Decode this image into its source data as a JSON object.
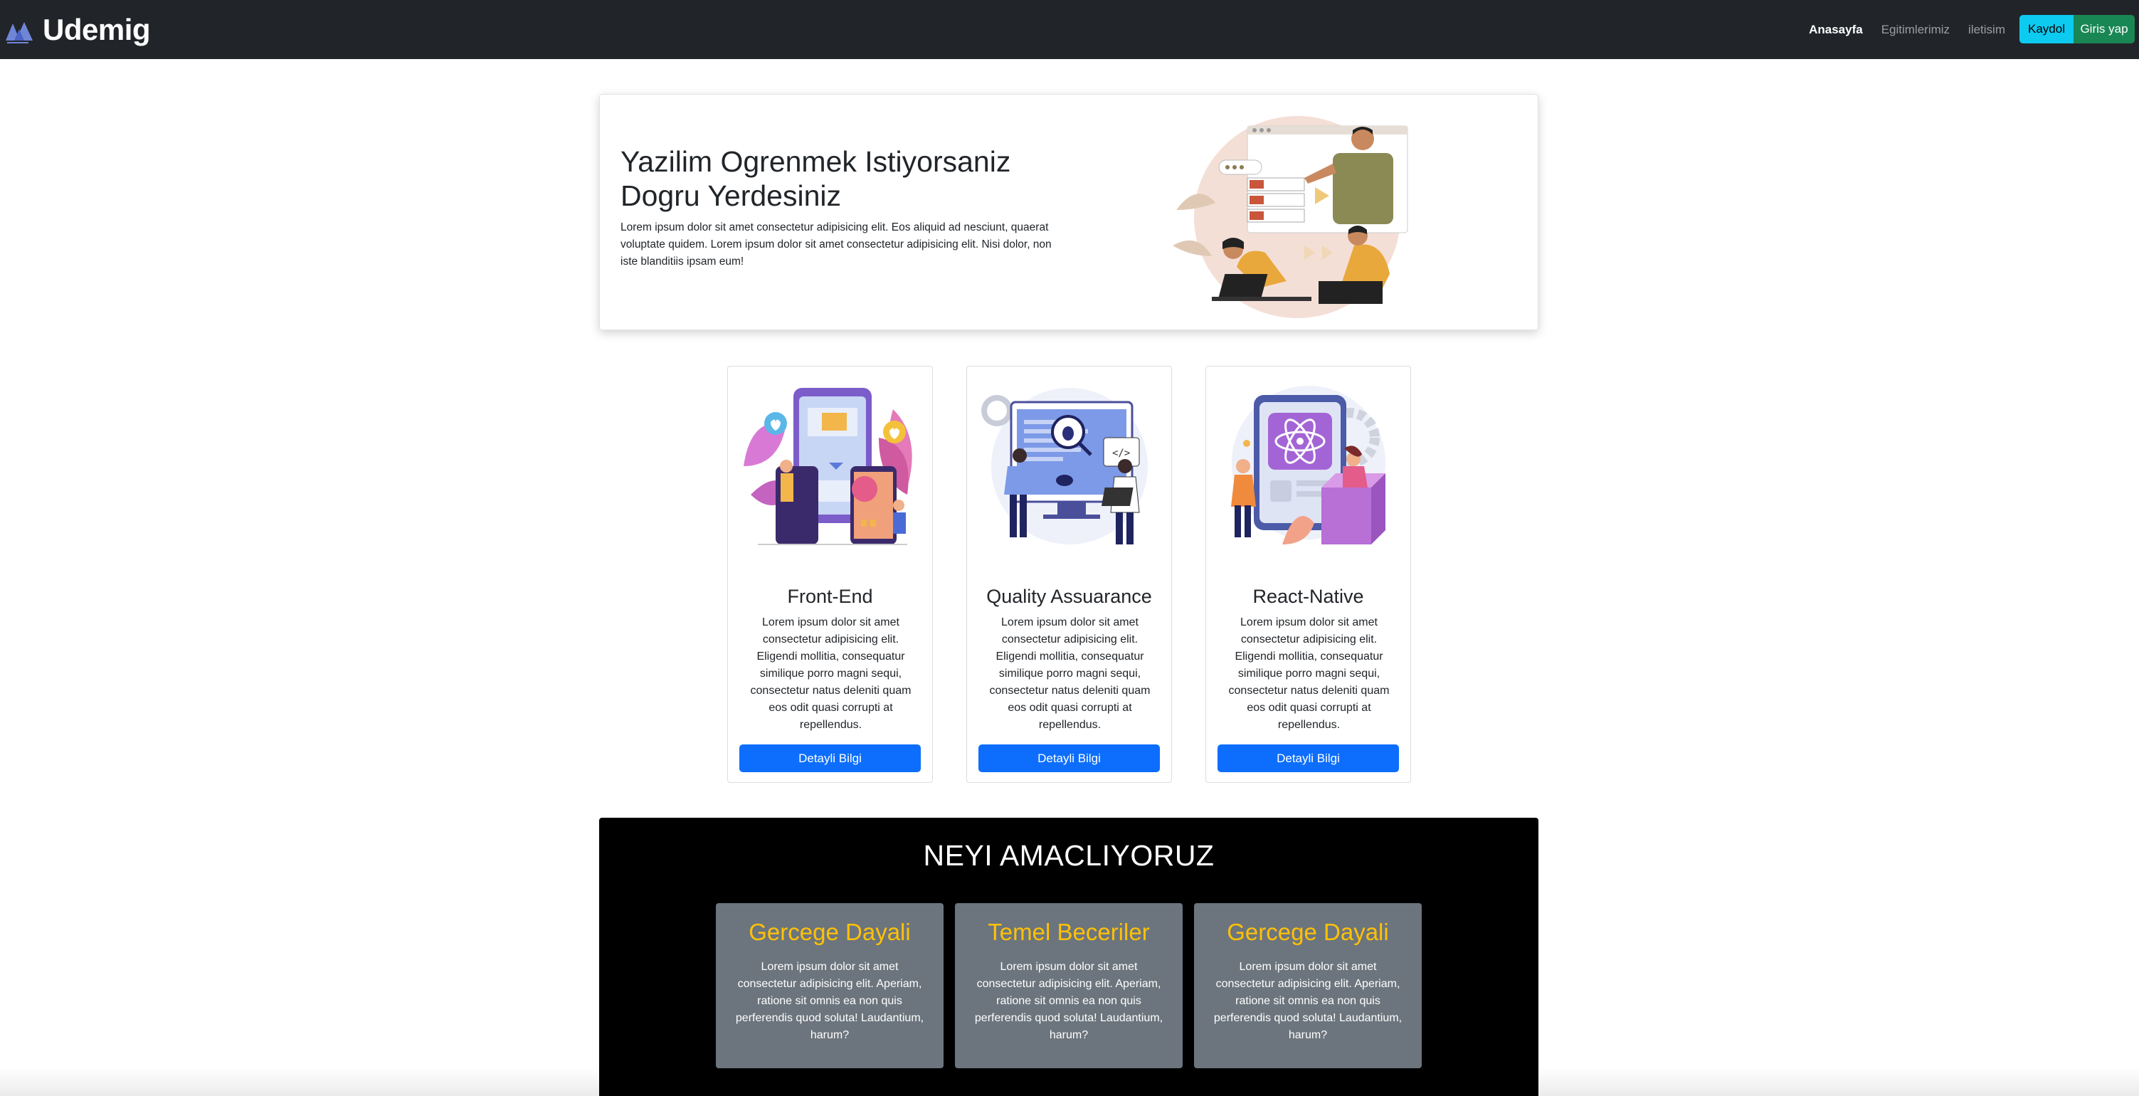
{
  "navbar": {
    "brand": "Udemig",
    "logo_icon": "udemig-logo-icon",
    "links": [
      {
        "label": "Anasayfa",
        "active": true
      },
      {
        "label": "Egitimlerimiz",
        "active": false
      },
      {
        "label": "iletisim",
        "active": false
      }
    ],
    "signup_label": "Kaydol",
    "login_label": "Giris yap",
    "colors": {
      "bg": "#212529",
      "signup": "#0dcaf0",
      "login": "#198754"
    }
  },
  "hero": {
    "title": "Yazilim Ogrenmek Istiyorsaniz Dogru Yerdesiniz",
    "text": "Lorem ipsum dolor sit amet consectetur adipisicing elit. Eos aliquid ad nesciunt, quaerat voluptate quidem. Lorem ipsum dolor sit amet consectetur adipisicing elit. Nisi dolor, non iste blanditiis ipsam eum!",
    "illustration": "teaching-presentation-illustration"
  },
  "cards": [
    {
      "title": "Front-End",
      "text": "Lorem ipsum dolor sit amet consectetur adipisicing elit. Eligendi mollitia, consequatur similique porro magni sequi, consectetur natus deleniti quam eos odit quasi corrupti at repellendus.",
      "button": "Detayli Bilgi",
      "illustration": "mobile-design-illustration"
    },
    {
      "title": "Quality Assuarance",
      "text": "Lorem ipsum dolor sit amet consectetur adipisicing elit. Eligendi mollitia, consequatur similique porro magni sequi, consectetur natus deleniti quam eos odit quasi corrupti at repellendus.",
      "button": "Detayli Bilgi",
      "illustration": "bug-testing-illustration"
    },
    {
      "title": "React-Native",
      "text": "Lorem ipsum dolor sit amet consectetur adipisicing elit. Eligendi mollitia, consequatur similique porro magni sequi, consectetur natus deleniti quam eos odit quasi corrupti at repellendus.",
      "button": "Detayli Bilgi",
      "illustration": "react-native-illustration"
    }
  ],
  "purpose": {
    "title": "NEYI AMACLIYORUZ",
    "boxes": [
      {
        "title": "Gercege Dayali",
        "text": "Lorem ipsum dolor sit amet consectetur adipisicing elit. Aperiam, ratione sit omnis ea non quis perferendis quod soluta! Laudantium, harum?"
      },
      {
        "title": "Temel Beceriler",
        "text": "Lorem ipsum dolor sit amet consectetur adipisicing elit. Aperiam, ratione sit omnis ea non quis perferendis quod soluta! Laudantium, harum?"
      },
      {
        "title": "Gercege Dayali",
        "text": "Lorem ipsum dolor sit amet consectetur adipisicing elit. Aperiam, ratione sit omnis ea non quis perferendis quod soluta! Laudantium, harum?"
      }
    ],
    "colors": {
      "bg": "#000000",
      "box": "#6c757d",
      "box_title": "#ffc107"
    }
  }
}
